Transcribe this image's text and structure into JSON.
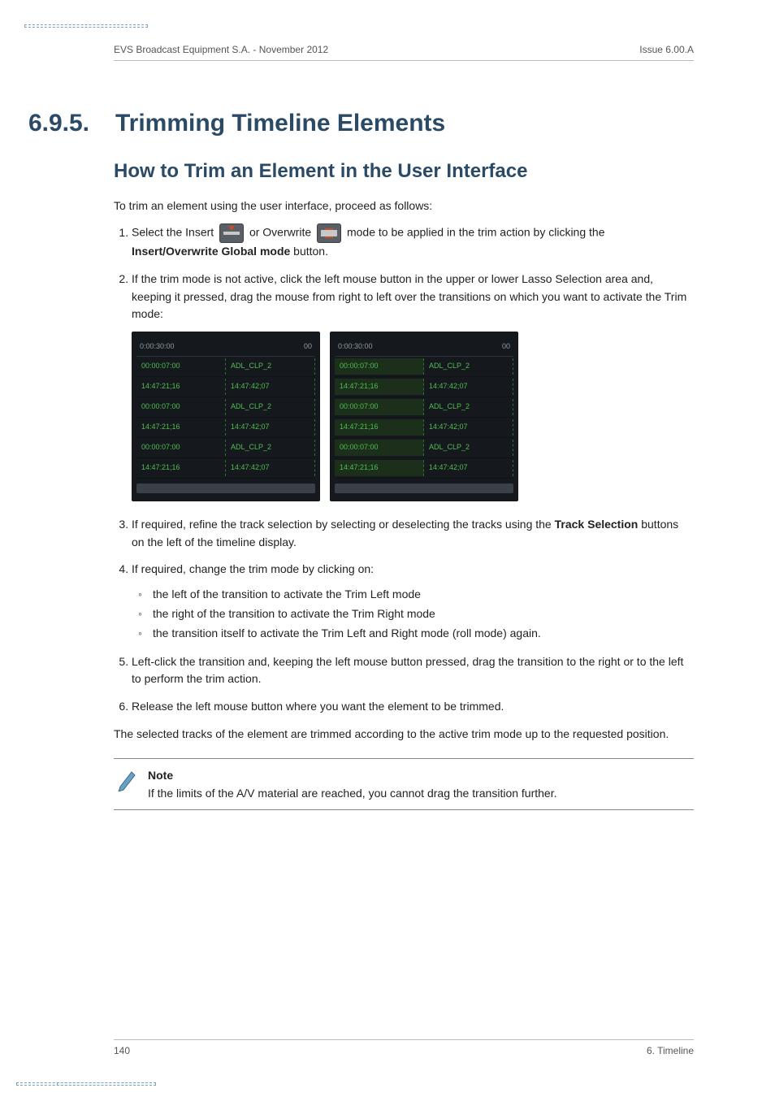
{
  "header": {
    "left": "EVS Broadcast Equipment S.A. - November 2012",
    "right": "Issue 6.00.A"
  },
  "section": {
    "number": "6.9.5.",
    "title": "Trimming Timeline Elements"
  },
  "subsection": {
    "title": "How to Trim an Element in the User Interface"
  },
  "intro": "To trim an element using the user interface, proceed as follows:",
  "steps": {
    "s1a": "Select the Insert ",
    "s1b": " or Overwrite ",
    "s1c": " mode to be applied in the trim action by clicking the ",
    "s1_bold": "Insert/Overwrite Global mode",
    "s1d": " button.",
    "s2": "If the trim mode is not active, click the left mouse button in the upper or lower Lasso Selection area and, keeping it pressed, drag the mouse from right to left over the transitions on which you want to activate the Trim mode:",
    "s3a": "If required, refine the track selection by selecting or deselecting the tracks using the ",
    "s3_bold": "Track Selection",
    "s3b": " buttons on the left of the timeline display.",
    "s4": "If required, change the trim mode by clicking on:",
    "s4_items": [
      "the left of the transition to activate the Trim Left mode",
      "the right of the transition to activate the Trim Right mode",
      "the transition itself to activate the Trim Left and Right mode (roll mode) again."
    ],
    "s5": "Left-click the transition and, keeping the left mouse button pressed, drag the transition to the right or to the left to perform the trim action.",
    "s6": "Release the left mouse button where you want the element to be trimmed."
  },
  "closing": "The selected tracks of the element are trimmed according to the active trim mode up to the requested position.",
  "note": {
    "label": "Note",
    "text": "If the limits of the A/V material are reached, you cannot drag the transition further."
  },
  "figure": {
    "ruler_left": "0:00:30:00",
    "ruler_right": "00",
    "rows": [
      {
        "tc": "00:00:07:00",
        "label": "ADL_CLP_2"
      },
      {
        "tc": "14:47:21;16",
        "label": "14:47:42;07"
      },
      {
        "tc": "00:00:07:00",
        "label": "ADL_CLP_2"
      },
      {
        "tc": "14:47:21;16",
        "label": "14:47:42;07"
      },
      {
        "tc": "00:00:07:00",
        "label": "ADL_CLP_2"
      },
      {
        "tc": "14:47:21;16",
        "label": "14:47:42;07"
      }
    ]
  },
  "footer": {
    "page": "140",
    "chapter": "6. Timeline"
  }
}
